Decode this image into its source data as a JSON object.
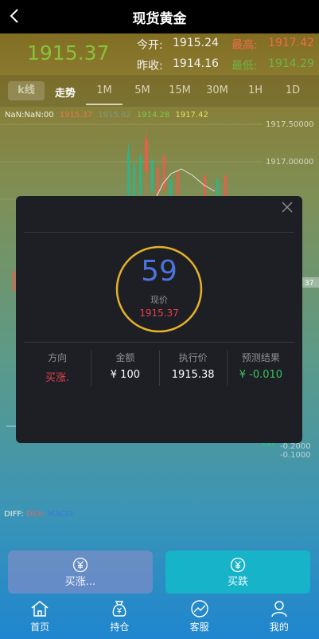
{
  "header": {
    "title": "现货黄金"
  },
  "quote": {
    "price": "1915.37",
    "open_label": "今开:",
    "open": "1915.24",
    "high_label": "最高:",
    "high": "1917.42",
    "close_label": "昨收:",
    "close": "1914.16",
    "low_label": "最低:",
    "low": "1914.29"
  },
  "periods": [
    "k线",
    "走势",
    "1M",
    "5M",
    "15M",
    "30M",
    "1H",
    "1D"
  ],
  "ma": {
    "time": "NaN:NaN:00",
    "v1": "1915.37",
    "v2": "1915.82",
    "v3": "1914.28",
    "v4": "1917.42"
  },
  "axis": {
    "upper": [
      "1917.50000",
      "1917.00000"
    ],
    "price_tag": "37",
    "lower": [
      "-0.2000",
      "-0.1000"
    ]
  },
  "macd": {
    "diff": "DIFF:",
    "dea": "DEA:",
    "macd": "MACD:"
  },
  "modal": {
    "countdown": "59",
    "now_label": "现价",
    "now_price": "1915.37",
    "columns": [
      {
        "head": "方向",
        "value": "买涨."
      },
      {
        "head": "金额",
        "value": "¥ 100"
      },
      {
        "head": "执行价",
        "value": "1915.38"
      },
      {
        "head": "预测结果",
        "value": "¥ -0.010"
      }
    ]
  },
  "buttons": {
    "up": "买涨...",
    "down": "买跌"
  },
  "nav": [
    "首页",
    "持仓",
    "客服",
    "我的"
  ],
  "colors": {
    "up": "#e0424f",
    "down": "#37c25e",
    "accent": "#4a74dc",
    "ring": "#e5b12a"
  }
}
